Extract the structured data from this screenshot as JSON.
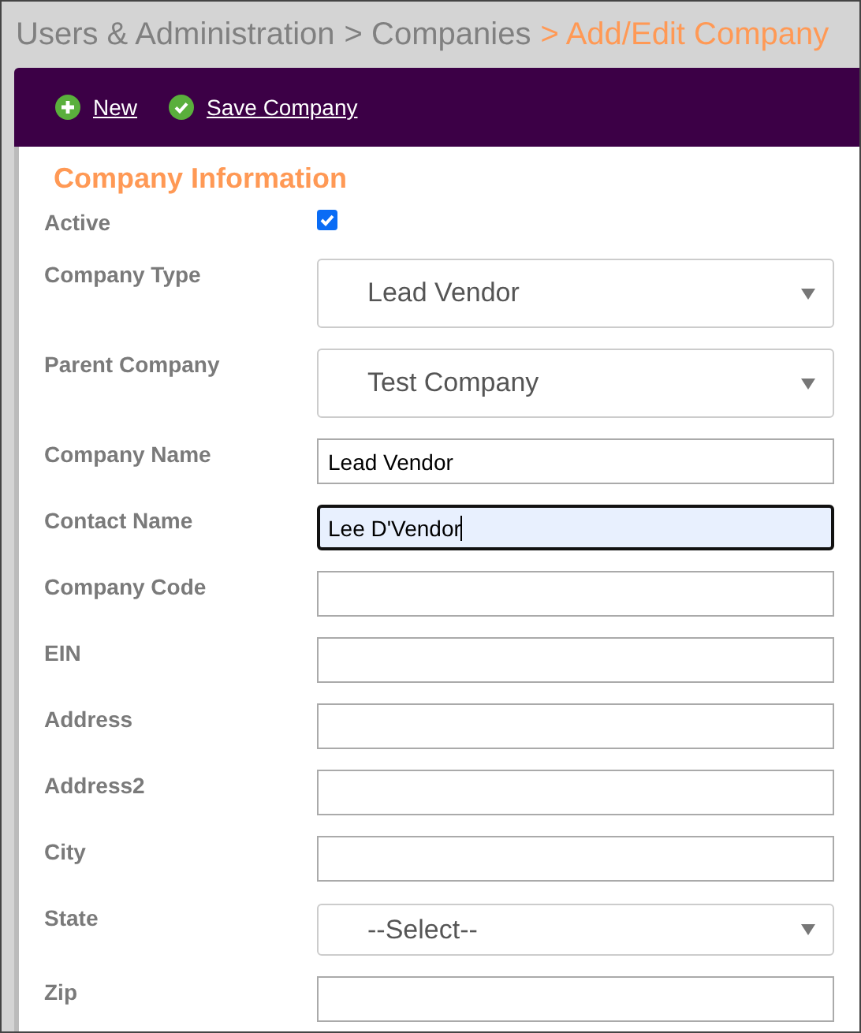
{
  "breadcrumb": [
    {
      "label": "Users & Administration",
      "current": false
    },
    {
      "label": "> Companies",
      "current": false
    },
    {
      "label": "> Add/Edit Company",
      "current": true
    }
  ],
  "toolbar": [
    {
      "kind": "new",
      "label": "New"
    },
    {
      "kind": "save",
      "label": "Save Company"
    }
  ],
  "section_title": "Company Information",
  "fields": [
    {
      "label": "Active",
      "kind": "checkbox",
      "checked": true
    },
    {
      "label": "Company Type",
      "kind": "select",
      "value": "Lead Vendor"
    },
    {
      "label": "Parent Company",
      "kind": "select",
      "value": "Test Company"
    },
    {
      "label": "Company Name",
      "kind": "text",
      "value": "Lead Vendor",
      "focused": false
    },
    {
      "label": "Contact Name",
      "kind": "text",
      "value": "Lee D'Vendor",
      "focused": true
    },
    {
      "label": "Company Code",
      "kind": "text",
      "focused": false
    },
    {
      "label": "EIN",
      "kind": "text",
      "focused": false
    },
    {
      "label": "Address",
      "kind": "text",
      "focused": false
    },
    {
      "label": "Address2",
      "kind": "text",
      "focused": false
    },
    {
      "label": "City",
      "kind": "text",
      "focused": false
    },
    {
      "label": "State",
      "kind": "compact-select",
      "value": "--Select--"
    },
    {
      "label": "Zip",
      "kind": "text",
      "focused": false
    }
  ]
}
